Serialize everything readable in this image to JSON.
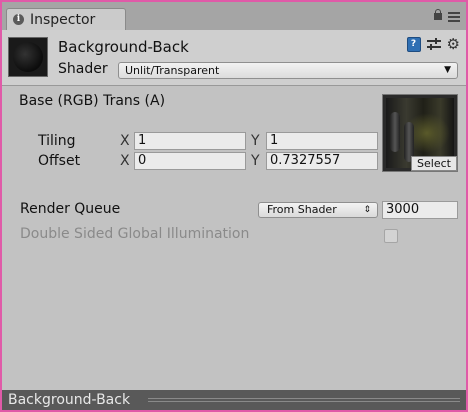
{
  "tab": {
    "title": "Inspector",
    "info_glyph": "i"
  },
  "header": {
    "material_name": "Background-Back",
    "shader_label": "Shader",
    "shader_value": "Unlit/Transparent",
    "help_glyph": "?"
  },
  "properties": {
    "base_label": "Base (RGB) Trans (A)",
    "tiling_label": "Tiling",
    "offset_label": "Offset",
    "x_label": "X",
    "y_label": "Y",
    "tiling_x": "1",
    "tiling_y": "1",
    "offset_x": "0",
    "offset_y": "0.7327557",
    "select_label": "Select"
  },
  "render_queue": {
    "label": "Render Queue",
    "mode": "From Shader",
    "value": "3000"
  },
  "double_sided": {
    "label": "Double Sided Global Illumination",
    "checked": false
  },
  "preview_bar": {
    "title": "Background-Back"
  },
  "colors": {
    "frame_border": "#e05aa8",
    "panel_bg": "#c2c2c2",
    "help_icon_blue": "#2f6fb3",
    "bottom_bar": "#595959"
  },
  "icons": [
    "info-icon",
    "lock-icon",
    "menu-icon",
    "help-book-icon",
    "sliders-icon",
    "gear-icon",
    "dropdown-arrow-icon"
  ]
}
